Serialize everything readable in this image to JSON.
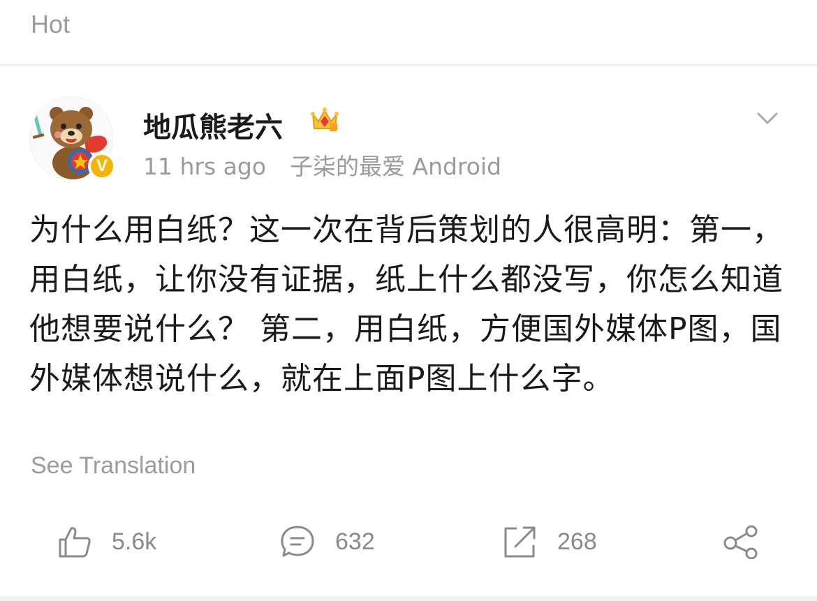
{
  "section": {
    "title": "Hot"
  },
  "post": {
    "username": "地瓜熊老六",
    "verified_badge": "V",
    "time": "11 hrs ago",
    "source": "子柒的最爱 Android",
    "content": "为什么用白纸？这一次在背后策划的人很高明：第一，用白纸，让你没有证据，纸上什么都没写，你怎么知道他想要说什么？ 第二，用白纸，方便国外媒体P图，国外媒体想说什么，就在上面P图上什么字。",
    "see_translation": "See Translation",
    "actions": {
      "like_count": "5.6k",
      "comment_count": "632",
      "repost_count": "268"
    }
  },
  "icons": {
    "like": "thumbs-up-icon",
    "comment": "comment-icon",
    "repost": "repost-icon",
    "share": "share-icon",
    "more": "chevron-down-icon",
    "crown": "crown-icon"
  },
  "colors": {
    "muted_text": "#9b9b9b",
    "verified": "#f5b400",
    "icon_gray": "#8a8a8a"
  }
}
